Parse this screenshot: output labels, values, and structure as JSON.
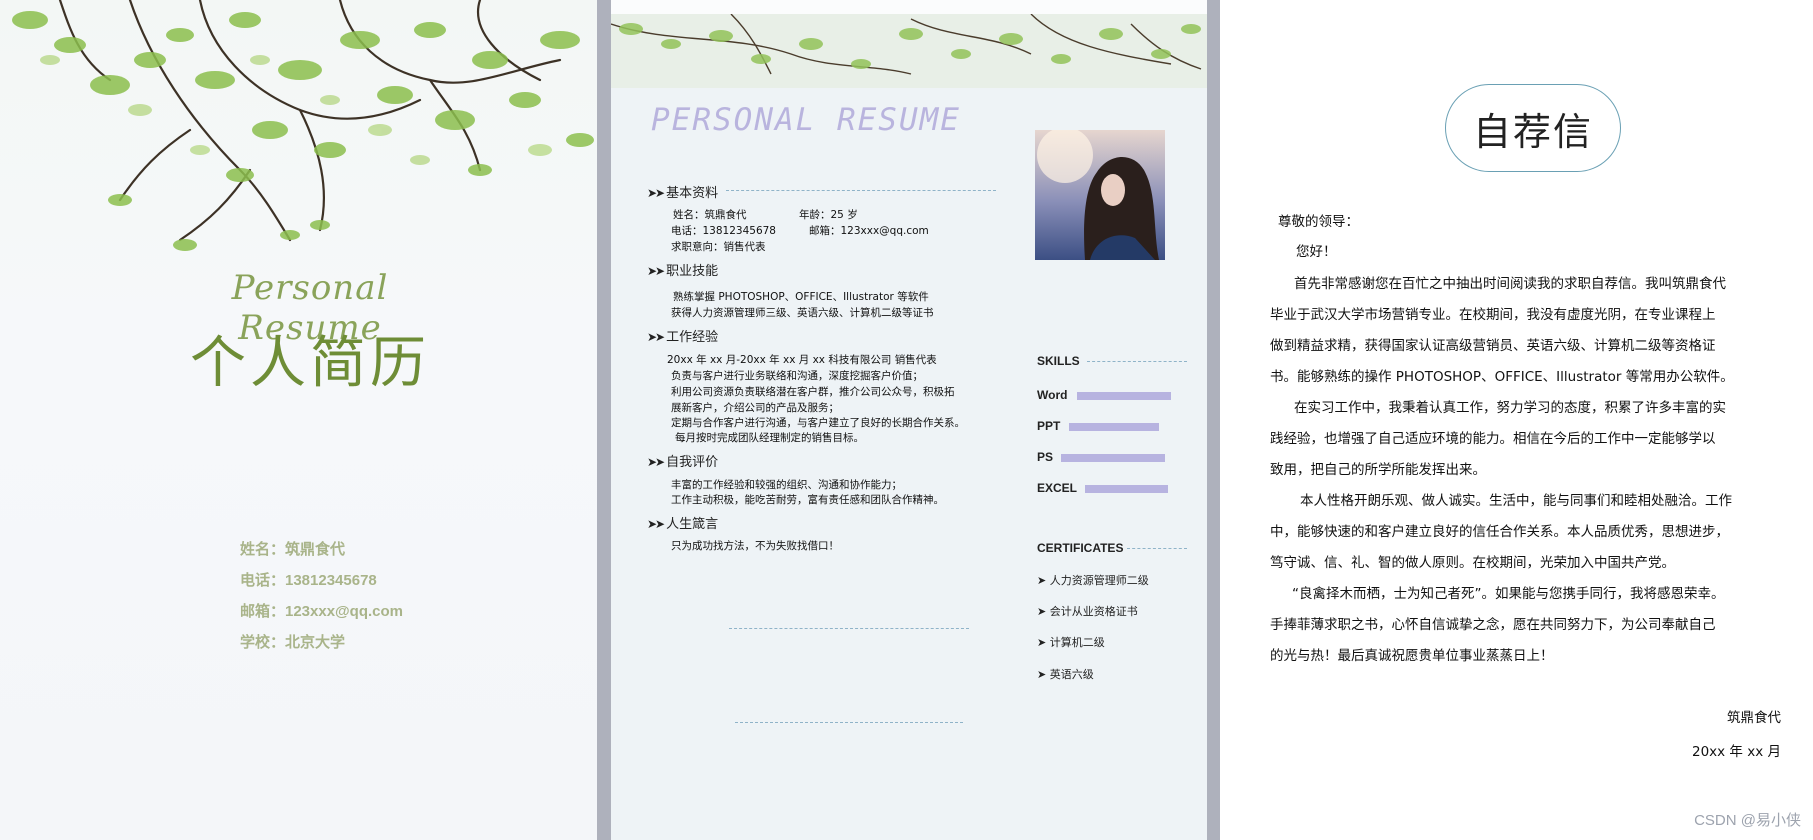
{
  "cover": {
    "script_title": "Personal Resume",
    "cn_title": "个人简历",
    "info": [
      "姓名：筑鼎食代",
      "电话：13812345678",
      "邮箱：123xxx@qq.com",
      "学校：北京大学"
    ]
  },
  "resume": {
    "title": "PERSONAL RESUME",
    "sections": {
      "basic": "基本资料",
      "skills": "职业技能",
      "work": "工作经验",
      "self": "自我评价",
      "motto": "人生箴言"
    },
    "basic": {
      "name": "姓名：筑鼎食代",
      "age": "年龄：25 岁",
      "phone": "电话：13812345678",
      "email": "邮箱：123xxx@qq.com",
      "intent": "求职意向：销售代表"
    },
    "skills_lines": [
      "熟练掌握 PHOTOSHOP、OFFICE、Illustrator 等软件",
      "获得人力资源管理师三级、英语六级、计算机二级等证书"
    ],
    "work_lines": [
      "20xx 年 xx 月-20xx 年 xx 月       xx 科技有限公司   销售代表",
      "负责与客户进行业务联络和沟通，深度挖掘客户价值；",
      "利用公司资源负责联络潜在客户群，推介公司公众号，积极拓",
      "展新客户，介绍公司的产品及服务；",
      "定期与合作客户进行沟通，与客户建立了良好的长期合作关系。",
      "每月按时完成团队经理制定的销售目标。"
    ],
    "self_lines": [
      "丰富的工作经验和较强的组织、沟通和协作能力；",
      "工作主动积极，能吃苦耐劳，富有责任感和团队合作精神。"
    ],
    "motto_line": "只为成功找方法，不为失败找借口！",
    "skills_title": "SKILLS",
    "skill_items": [
      {
        "label": "Word",
        "level": 0.82
      },
      {
        "label": "PPT",
        "level": 0.78
      },
      {
        "label": "PS",
        "level": 0.9
      },
      {
        "label": "EXCEL",
        "level": 0.72
      }
    ],
    "certificates_title": "CERTIFICATES",
    "certificates": [
      "人力资源管理师二级",
      "会计从业资格证书",
      "计算机二级",
      "英语六级"
    ],
    "accent_color": "#b7b3e0"
  },
  "letter": {
    "title": "自荐信",
    "greeting": "尊敬的领导：",
    "hello": "您好！",
    "lines": [
      "首先非常感谢您在百忙之中抽出时间阅读我的求职自荐信。我叫筑鼎食代",
      "毕业于武汉大学市场营销专业。在校期间，我没有虚度光阴，在专业课程上",
      "做到精益求精，获得国家认证高级营销员、英语六级、计算机二级等资格证",
      "书。能够熟练的操作 PHOTOSHOP、OFFICE、Illustrator 等常用办公软件。",
      "在实习工作中，我秉着认真工作，努力学习的态度，积累了许多丰富的实",
      "践经验，也增强了自己适应环境的能力。相信在今后的工作中一定能够学以",
      "致用，把自己的所学所能发挥出来。",
      "本人性格开朗乐观、做人诚实。生活中，能与同事们和睦相处融洽。工作",
      "中，能够快速的和客户建立良好的信任合作关系。本人品质优秀，思想进步，",
      "笃守诚、信、礼、智的做人原则。在校期间，光荣加入中国共产党。",
      "“良禽择木而栖，士为知己者死”。如果能与您携手同行，我将感恩荣幸。",
      "手捧菲薄求职之书，心怀自信诚挚之念，愿在共同努力下，为公司奉献自己",
      "的光与热！最后真诚祝愿贵单位事业蒸蒸日上！"
    ],
    "signature": "筑鼎食代",
    "date": "20xx 年 xx 月"
  },
  "watermark": "CSDN @易小侠"
}
